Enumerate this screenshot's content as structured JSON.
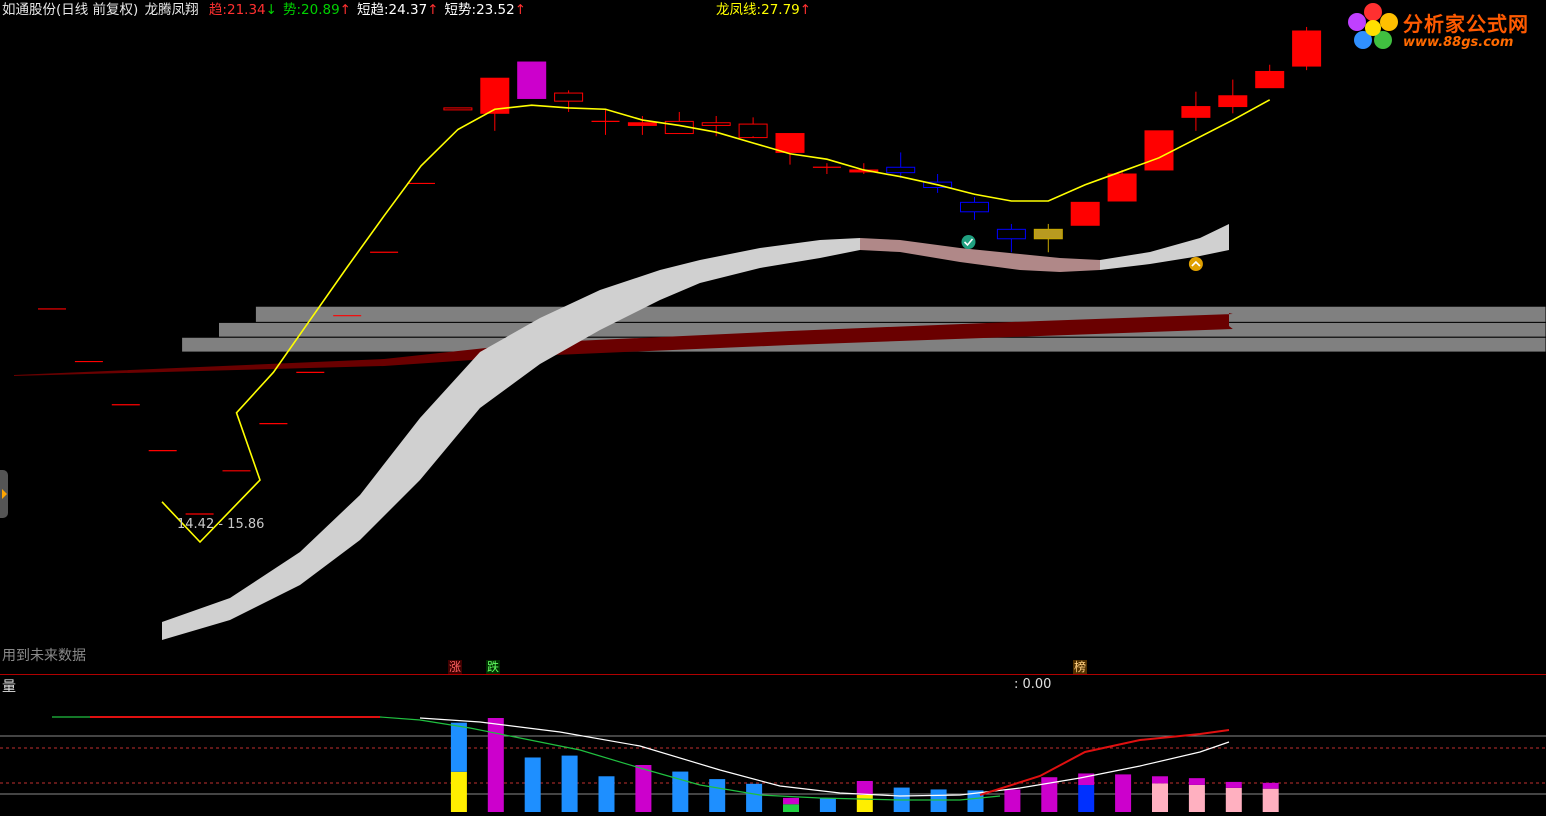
{
  "header": {
    "stock_name": "如通股份",
    "period": "(日线 前复权)",
    "indicator_name": "龙腾凤翔",
    "items": [
      {
        "label": "趋",
        "value": "21.34",
        "arrow": "↓",
        "label_color": "#ff3030",
        "value_color": "#ff3030",
        "arrow_color": "#00d000",
        "x": 0
      },
      {
        "label": "势",
        "value": "20.89",
        "arrow": "↑",
        "label_color": "#00d000",
        "value_color": "#00d000",
        "arrow_color": "#ff3030",
        "x": 0
      },
      {
        "label": "短趋",
        "value": "24.37",
        "arrow": "↑",
        "label_color": "#ffffff",
        "value_color": "#ffffff",
        "arrow_color": "#ff3030",
        "x": 0
      },
      {
        "label": "短势",
        "value": "23.52",
        "arrow": "↑",
        "label_color": "#ffffff",
        "value_color": "#ffffff",
        "arrow_color": "#ff3030",
        "x": 0
      },
      {
        "label": "龙凤线",
        "value": "27.79",
        "arrow": "↑",
        "label_color": "#ffff00",
        "value_color": "#ffff00",
        "arrow_color": "#ff3030",
        "x": 1
      }
    ]
  },
  "watermark": {
    "name": "分析家公式网",
    "url": "www.88gs.com"
  },
  "main_chart": {
    "range_label": "14.42 - 15.86",
    "future_data_notice": "用到未来数据",
    "candles": [
      {
        "o": 23.45,
        "c": 23.45,
        "h": 23.45,
        "l": 23.45
      },
      {
        "o": 21.5,
        "c": 21.5,
        "h": 21.5,
        "l": 21.5
      },
      {
        "o": 19.9,
        "c": 19.9,
        "h": 19.9,
        "l": 19.9
      },
      {
        "o": 18.2,
        "c": 18.2,
        "h": 18.2,
        "l": 18.2
      },
      {
        "o": 15.85,
        "c": 15.85,
        "h": 15.85,
        "l": 15.85
      },
      {
        "o": 17.45,
        "c": 17.45,
        "h": 17.45,
        "l": 17.45
      },
      {
        "o": 19.2,
        "c": 19.2,
        "h": 19.2,
        "l": 19.2
      },
      {
        "o": 21.1,
        "c": 21.1,
        "h": 21.1,
        "l": 21.1
      },
      {
        "o": 23.2,
        "c": 23.2,
        "h": 23.2,
        "l": 23.2
      },
      {
        "o": 25.55,
        "c": 25.55,
        "h": 25.55,
        "l": 25.55
      },
      {
        "o": 28.1,
        "c": 28.1,
        "h": 28.1,
        "l": 28.1
      },
      {
        "o": 30.9,
        "c": 30.9,
        "h": 30.9,
        "l": 30.9
      },
      {
        "o": 30.7,
        "c": 32.0,
        "h": 32.0,
        "l": 30.05
      },
      {
        "o": 31.25,
        "c": 32.6,
        "h": 32.6,
        "l": 31.25
      },
      {
        "o": 31.15,
        "c": 31.45,
        "h": 31.55,
        "l": 30.75
      },
      {
        "o": 30.4,
        "c": 30.55,
        "h": 30.85,
        "l": 29.9
      },
      {
        "o": 30.25,
        "c": 30.35,
        "h": 30.6,
        "l": 29.9
      },
      {
        "o": 29.95,
        "c": 30.4,
        "h": 30.75,
        "l": 29.95
      },
      {
        "o": 30.25,
        "c": 30.35,
        "h": 30.6,
        "l": 29.85
      },
      {
        "o": 30.3,
        "c": 29.8,
        "h": 30.55,
        "l": 29.85
      },
      {
        "o": 29.25,
        "c": 29.95,
        "h": 29.95,
        "l": 28.8
      },
      {
        "o": 28.7,
        "c": 28.6,
        "h": 28.85,
        "l": 28.45
      },
      {
        "o": 28.6,
        "c": 28.6,
        "h": 28.85,
        "l": 28.45
      },
      {
        "o": 28.5,
        "c": 28.7,
        "h": 29.25,
        "l": 28.3
      },
      {
        "o": 28.15,
        "c": 27.95,
        "h": 28.45,
        "l": 27.75
      },
      {
        "o": 27.4,
        "c": 27.05,
        "h": 27.6,
        "l": 26.75
      },
      {
        "o": 26.4,
        "c": 26.05,
        "h": 26.6,
        "l": 25.55
      },
      {
        "o": 26.4,
        "c": 26.05,
        "h": 26.6,
        "l": 25.55
      },
      {
        "o": 26.55,
        "c": 27.4,
        "h": 27.4,
        "l": 26.65
      },
      {
        "o": 27.45,
        "c": 28.45,
        "h": 28.6,
        "l": 27.45
      },
      {
        "o": 28.6,
        "c": 30.05,
        "h": 30.05,
        "l": 28.6
      },
      {
        "o": 30.55,
        "c": 30.95,
        "h": 31.5,
        "l": 30.05
      },
      {
        "o": 30.95,
        "c": 31.35,
        "h": 31.95,
        "l": 30.7
      },
      {
        "o": 31.65,
        "c": 32.25,
        "h": 32.5,
        "l": 31.65
      },
      {
        "o": 32.45,
        "c": 33.75,
        "h": 33.9,
        "l": 32.3
      }
    ],
    "candle_styles": [
      "dash",
      "dash",
      "dash",
      "dash",
      "dash",
      "dash",
      "dash",
      "dash",
      "dash",
      "dash",
      "dash",
      "hollow-red",
      "solid-red",
      "magenta",
      "hollow-red",
      "cross-red",
      "solid-red",
      "hollow-red",
      "hollow-red",
      "hollow-red",
      "solid-red",
      "cross-red",
      "solid-red",
      "hollow-blue",
      "hollow-blue",
      "hollow-blue",
      "hollow-blue",
      "gold",
      "solid-red",
      "solid-red",
      "solid-red",
      "solid-red",
      "solid-red",
      "solid-red",
      "solid-red"
    ],
    "longfeng_line": [
      16.3,
      null,
      null,
      null,
      null,
      19.6,
      21.1,
      23.05,
      25.0,
      26.9,
      28.75,
      30.1,
      30.85,
      31.0,
      30.9,
      30.85,
      30.45,
      30.25,
      30.0,
      29.6,
      29.2,
      29.0,
      28.6,
      28.35,
      28.05,
      27.7,
      27.45,
      27.45,
      28.05,
      28.55,
      29.05,
      29.75,
      30.45,
      31.2
    ],
    "gray_boxes": [
      {
        "price_top": 23.55,
        "price_bottom": 22.95,
        "from_bar": 6
      },
      {
        "price_top": 22.95,
        "price_bottom": 22.4,
        "from_bar": 5
      },
      {
        "price_top": 22.4,
        "price_bottom": 21.85,
        "from_bar": 4
      }
    ],
    "markers": [
      {
        "type": "check",
        "bar": 25,
        "price": 29.2,
        "color": "#20a080"
      },
      {
        "type": "up",
        "bar": 31,
        "price": 28.7,
        "color": "#e0a000"
      }
    ]
  },
  "volume_panel": {
    "label": "量",
    "value": ": 0.00",
    "signals": {
      "up": "涨",
      "down": "跌",
      "top": "榜"
    },
    "bars": [
      {
        "bar": 11,
        "h": 0.95,
        "seg": [
          [
            "#ffee00",
            0.45
          ],
          [
            "#1e8fff",
            0.55
          ]
        ]
      },
      {
        "bar": 12,
        "h": 1.0,
        "seg": [
          [
            "#cc00cc",
            1.0
          ]
        ]
      },
      {
        "bar": 13,
        "h": 0.58,
        "seg": [
          [
            "#1e8fff",
            1.0
          ]
        ]
      },
      {
        "bar": 14,
        "h": 0.6,
        "seg": [
          [
            "#1e8fff",
            1.0
          ]
        ]
      },
      {
        "bar": 15,
        "h": 0.38,
        "seg": [
          [
            "#1e8fff",
            1.0
          ]
        ]
      },
      {
        "bar": 16,
        "h": 0.5,
        "seg": [
          [
            "#cc00cc",
            1.0
          ]
        ]
      },
      {
        "bar": 17,
        "h": 0.43,
        "seg": [
          [
            "#1e8fff",
            1.0
          ]
        ]
      },
      {
        "bar": 18,
        "h": 0.35,
        "seg": [
          [
            "#1e8fff",
            1.0
          ]
        ]
      },
      {
        "bar": 19,
        "h": 0.3,
        "seg": [
          [
            "#1e8fff",
            1.0
          ]
        ]
      },
      {
        "bar": 20,
        "h": 0.15,
        "seg": [
          [
            "#20d040",
            0.55
          ],
          [
            "#cc00cc",
            0.45
          ]
        ]
      },
      {
        "bar": 21,
        "h": 0.15,
        "seg": [
          [
            "#1e8fff",
            1.0
          ]
        ]
      },
      {
        "bar": 22,
        "h": 0.33,
        "seg": [
          [
            "#ffee00",
            0.55
          ],
          [
            "#cc00cc",
            0.45
          ]
        ]
      },
      {
        "bar": 23,
        "h": 0.26,
        "seg": [
          [
            "#1e8fff",
            1.0
          ]
        ]
      },
      {
        "bar": 24,
        "h": 0.24,
        "seg": [
          [
            "#1e8fff",
            1.0
          ]
        ]
      },
      {
        "bar": 25,
        "h": 0.23,
        "seg": [
          [
            "#1e8fff",
            1.0
          ]
        ]
      },
      {
        "bar": 26,
        "h": 0.24,
        "seg": [
          [
            "#cc00cc",
            1.0
          ]
        ]
      },
      {
        "bar": 27,
        "h": 0.37,
        "seg": [
          [
            "#cc00cc",
            1.0
          ]
        ]
      },
      {
        "bar": 28,
        "h": 0.41,
        "seg": [
          [
            "#0030ff",
            0.7
          ],
          [
            "#cc00cc",
            0.3
          ]
        ]
      },
      {
        "bar": 29,
        "h": 0.4,
        "seg": [
          [
            "#cc00cc",
            1.0
          ]
        ]
      },
      {
        "bar": 30,
        "h": 0.38,
        "seg": [
          [
            "#ffb0c0",
            0.8
          ],
          [
            "#cc00cc",
            0.2
          ]
        ]
      },
      {
        "bar": 31,
        "h": 0.36,
        "seg": [
          [
            "#ffb0c0",
            0.8
          ],
          [
            "#cc00cc",
            0.2
          ]
        ]
      },
      {
        "bar": 32,
        "h": 0.32,
        "seg": [
          [
            "#ffb0c0",
            0.8
          ],
          [
            "#cc00cc",
            0.2
          ]
        ]
      },
      {
        "bar": 33,
        "h": 0.31,
        "seg": [
          [
            "#ffb0c0",
            0.8
          ],
          [
            "#cc00cc",
            0.2
          ]
        ]
      }
    ]
  },
  "colors": {
    "background": "#000000",
    "up": "#ff0000",
    "down": "#0000ff",
    "longfeng": "#ffff00",
    "band_white": "#d0d0d0",
    "band_dark_red": "#6a0000",
    "gray_box": "#808080"
  }
}
